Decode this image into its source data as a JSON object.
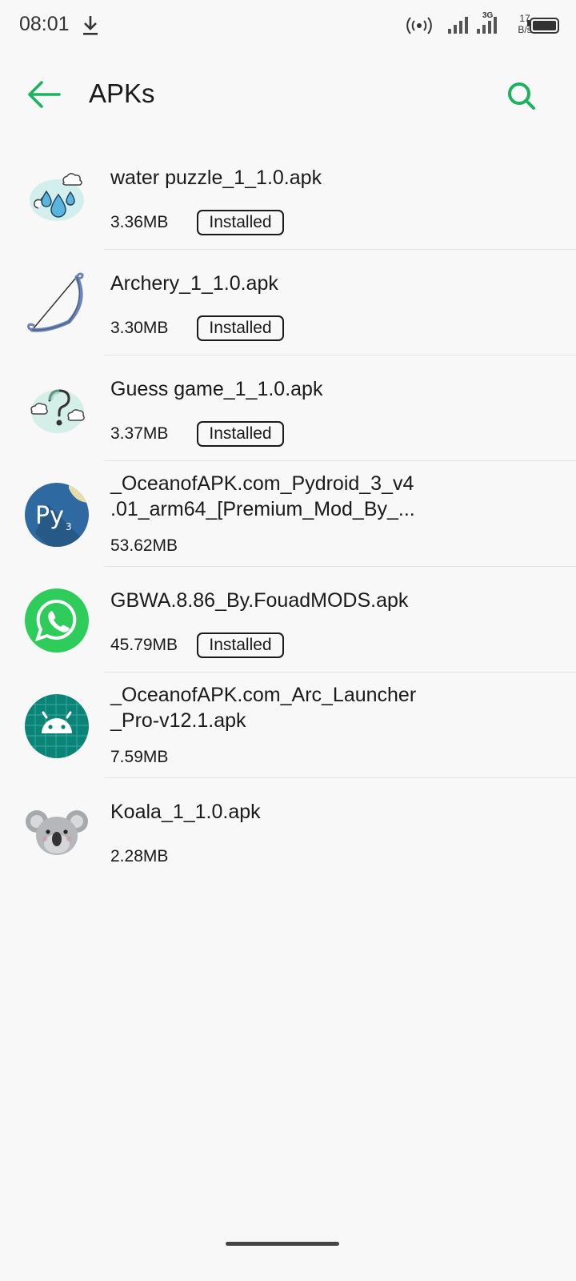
{
  "status": {
    "time": "08:01",
    "network_type": "3G",
    "net_speed_value": "17",
    "net_speed_unit": "B/s",
    "icons": [
      "download-icon",
      "hotspot-icon",
      "signal-icon",
      "signal-icon",
      "battery-icon"
    ]
  },
  "header": {
    "title": "APKs",
    "accent": "#1bb35f"
  },
  "files": [
    {
      "name": "water puzzle_1_1.0.apk",
      "size": "3.36MB",
      "badge": "Installed",
      "icon": "water-drops-icon"
    },
    {
      "name": "Archery_1_1.0.apk",
      "size": "3.30MB",
      "badge": "Installed",
      "icon": "bow-icon"
    },
    {
      "name": "Guess game_1_1.0.apk",
      "size": "3.37MB",
      "badge": "Installed",
      "icon": "question-cloud-icon"
    },
    {
      "name": "_OceanofAPK.com_Pydroid_3_v4\n.01_arm64_[Premium_Mod_By_...",
      "size": "53.62MB",
      "badge": "",
      "icon": "pydroid-icon"
    },
    {
      "name": "GBWA.8.86_By.FouadMODS.apk",
      "size": "45.79MB",
      "badge": "Installed",
      "icon": "whatsapp-icon"
    },
    {
      "name": "_OceanofAPK.com_Arc_Launcher\n_Pro-v12.1.apk",
      "size": "7.59MB",
      "badge": "",
      "icon": "android-icon"
    },
    {
      "name": "Koala_1_1.0.apk",
      "size": "2.28MB",
      "badge": "",
      "icon": "koala-icon"
    }
  ]
}
